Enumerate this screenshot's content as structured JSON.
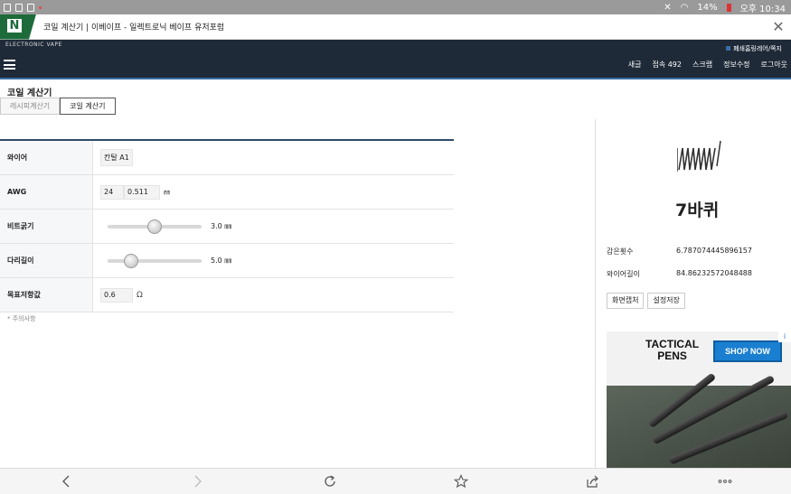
{
  "status_bar": {
    "battery": "14%",
    "time": "오후 10:34"
  },
  "browser_tab": {
    "logo_letter": "N",
    "title": "코일 계산기 | 이베이프 - 일렉트로닉 베이프 유저포럼",
    "close_icon": "close-icon"
  },
  "site_header": {
    "brand": "ELECTRONIC VAPE",
    "notice": "폐쇄홈링레어/쪽지",
    "menu": [
      "새글",
      "접속 492",
      "스크랩",
      "정보수정",
      "로그아웃"
    ]
  },
  "page": {
    "title": "코일 계산기",
    "tabs": [
      {
        "label": "레시피계산기",
        "active": false
      },
      {
        "label": "코일 계산기",
        "active": true
      }
    ]
  },
  "calculator": {
    "wire": {
      "label": "와이어",
      "value": "칸탈 A1"
    },
    "awg": {
      "label": "AWG",
      "gauge": "24",
      "diameter": "0.511",
      "unit": "㎜"
    },
    "rod": {
      "label": "비트굵기",
      "value": "3.0 ㎜",
      "slider_fraction": 0.5
    },
    "leg": {
      "label": "다리길이",
      "value": "5.0 ㎜",
      "slider_fraction": 0.2
    },
    "target": {
      "label": "목표저항값",
      "value": "0.6",
      "unit": "Ω"
    },
    "note": "* 주의사항"
  },
  "result": {
    "coil_icon": "coil-icon",
    "wraps_text": "7바퀴",
    "stats": [
      {
        "label": "감은횟수",
        "value": "6.787074445896157"
      },
      {
        "label": "와이어길이",
        "value": "84.86232572048488"
      }
    ],
    "buttons": [
      "화면캡처",
      "설정저장"
    ]
  },
  "ad": {
    "title_line1": "TACTICAL",
    "title_line2": "PENS",
    "cta": "SHOP NOW",
    "badge": "i"
  },
  "bottom_nav": [
    "back-icon",
    "forward-icon",
    "reload-icon",
    "star-icon",
    "share-icon",
    "more-icon"
  ]
}
